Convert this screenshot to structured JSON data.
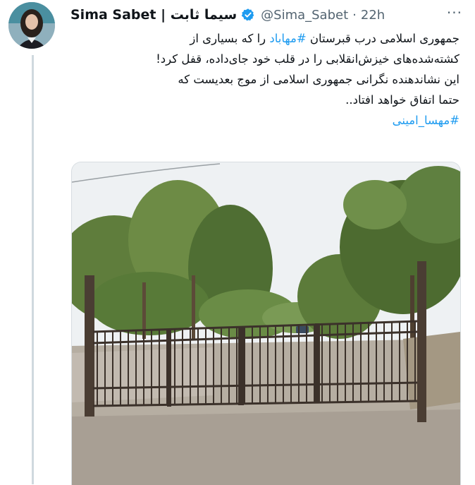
{
  "tweet": {
    "author_name": "Sima Sabet | سیما ثابت",
    "handle": "@Sima_Sabet",
    "separator": "·",
    "time": "22h",
    "more": "···",
    "text_line1_a": "جمهوری  اسلامی درب قبرستان ",
    "hashtag_city": "#مهاباد",
    "text_line1_b": " را که بسیاری از",
    "text_line2": "کشته‌شده‌های خیزش‌انقلابی را در قلب خود جای‌داده، قفل کرد!",
    "text_line3": "این نشاندهنده نگرانی جمهوری اسلامی از موج بعدیست که",
    "text_line4": "حتما اتفاق خواهد افتاد..",
    "hashtag_name": "#مهسا_امینی"
  },
  "colors": {
    "link": "#1d9bf0",
    "verified": "#1d9bf0",
    "text": "#0f1419",
    "secondary": "#536471"
  },
  "icons": {
    "verified": "verified-badge-icon",
    "more": "more-horizontal-icon"
  }
}
